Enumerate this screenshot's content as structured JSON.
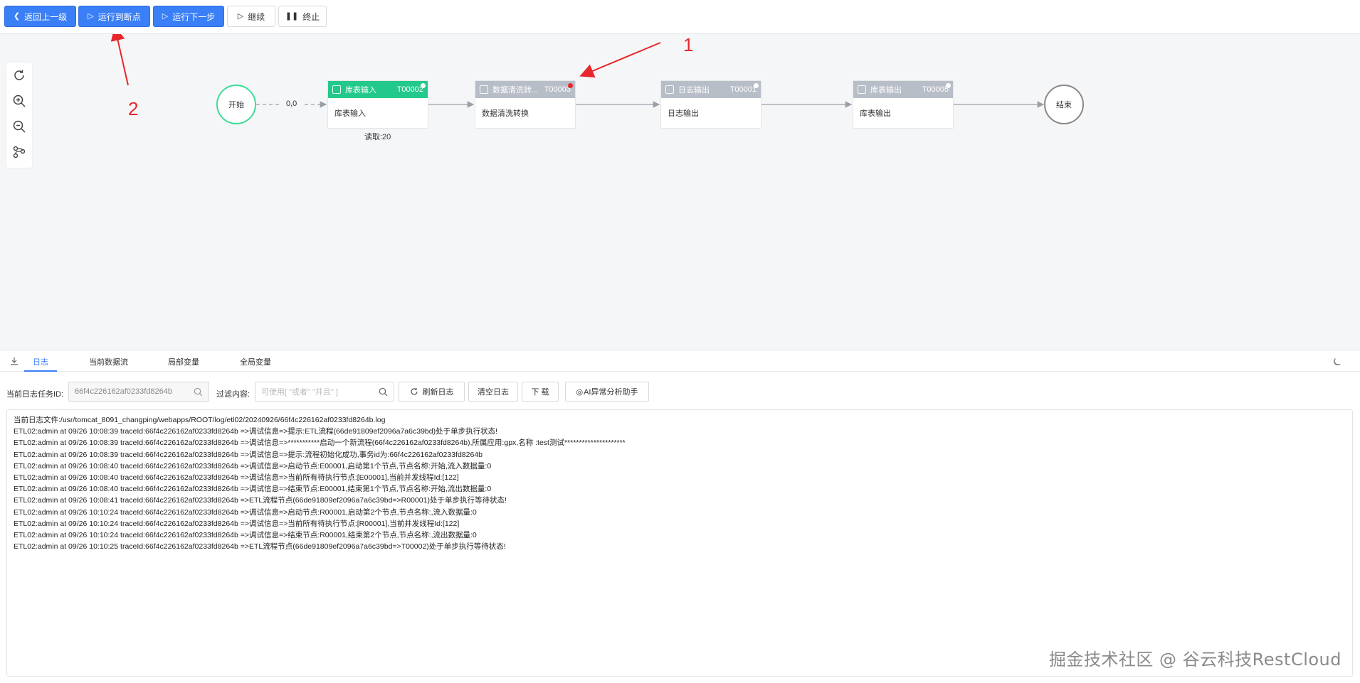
{
  "toolbar": {
    "back_label": "返回上一级",
    "run_to_breakpoint_label": "运行到断点",
    "run_next_step_label": "运行下一步",
    "continue_label": "继续",
    "stop_label": "终止"
  },
  "flow": {
    "start_label": "开始",
    "end_label": "结束",
    "edge_label": "0,0",
    "nodes": [
      {
        "title": "库表输入",
        "code": "T00002",
        "body": "库表输入",
        "status": "active",
        "footer": "读取:20"
      },
      {
        "title": "数据清洗转...",
        "code": "T00003",
        "body": "数据清洗转换",
        "status": "breakpoint",
        "footer": ""
      },
      {
        "title": "日志输出",
        "code": "T00001",
        "body": "日志输出",
        "status": "idle",
        "footer": ""
      },
      {
        "title": "库表输出",
        "code": "T00005",
        "body": "库表输出",
        "status": "idle",
        "footer": ""
      }
    ]
  },
  "annotations": {
    "label_1": "1",
    "label_2": "2",
    "color": "#e8262b"
  },
  "tabs": [
    {
      "label": "日志",
      "active": true
    },
    {
      "label": "当前数据流",
      "active": false
    },
    {
      "label": "局部变量",
      "active": false
    },
    {
      "label": "全局变量",
      "active": false
    }
  ],
  "filters": {
    "task_id_label": "当前日志任务ID:",
    "task_id_value": "66f4c226162af0233fd8264b",
    "filter_label": "过滤内容:",
    "filter_placeholder": "可使用[ \"或者\"  \"并且\" ]",
    "refresh_label": "刷新日志",
    "clear_label": "清空日志",
    "download_label": "下 载",
    "ai_label": "AI异常分析助手"
  },
  "log": {
    "lines": [
      "当前日志文件:/usr/tomcat_8091_changping/webapps/ROOT/log/etl02/20240926/66f4c226162af0233fd8264b.log",
      "ETL02:admin at 09/26 10:08:39 traceId:66f4c226162af0233fd8264b =>调试信息=>提示:ETL流程(66de91809ef2096a7a6c39bd)处于单步执行状态!",
      "ETL02:admin at 09/26 10:08:39 traceId:66f4c226162af0233fd8264b =>调试信息=>***********启动一个新流程(66f4c226162af0233fd8264b),所属应用:gpx,名称 :test测试*********************",
      "ETL02:admin at 09/26 10:08:39 traceId:66f4c226162af0233fd8264b =>调试信息=>提示:流程初始化成功,事务id为:66f4c226162af0233fd8264b",
      "ETL02:admin at 09/26 10:08:40 traceId:66f4c226162af0233fd8264b =>调试信息=>启动节点:E00001,启动第1个节点,节点名称:开始,流入数据量:0",
      "ETL02:admin at 09/26 10:08:40 traceId:66f4c226162af0233fd8264b =>调试信息=>当前所有待执行节点:[E00001],当前并发线程Id:[122]",
      "ETL02:admin at 09/26 10:08:40 traceId:66f4c226162af0233fd8264b =>调试信息=>结束节点:E00001,结束第1个节点,节点名称:开始,流出数据量:0",
      "ETL02:admin at 09/26 10:08:41 traceId:66f4c226162af0233fd8264b =>ETL流程节点(66de91809ef2096a7a6c39bd=>R00001)处于单步执行等待状态!",
      "ETL02:admin at 09/26 10:10:24 traceId:66f4c226162af0233fd8264b =>调试信息=>启动节点:R00001,启动第2个节点,节点名称:,流入数据量:0",
      "ETL02:admin at 09/26 10:10:24 traceId:66f4c226162af0233fd8264b =>调试信息=>当前所有待执行节点:[R00001],当前并发线程Id:[122]",
      "ETL02:admin at 09/26 10:10:24 traceId:66f4c226162af0233fd8264b =>调试信息=>结束节点:R00001,结束第2个节点,节点名称:,流出数据量:0",
      "ETL02:admin at 09/26 10:10:25 traceId:66f4c226162af0233fd8264b =>ETL流程节点(66de91809ef2096a7a6c39bd=>T00002)处于单步执行等待状态!"
    ]
  },
  "watermark": "掘金技术社区 @ 谷云科技RestCloud",
  "colors": {
    "primary": "#3b7ff6",
    "node_active": "#22c98a",
    "node_idle": "#b8bec8",
    "breakpoint": "#e8262b"
  }
}
